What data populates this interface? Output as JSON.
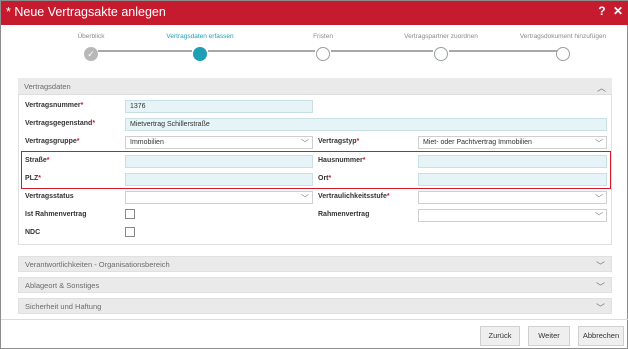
{
  "window": {
    "title": "* Neue Vertragsakte anlegen",
    "help_icon": "?",
    "close_icon": "✕"
  },
  "stepper": {
    "steps": [
      {
        "label": "Überblick",
        "state": "done"
      },
      {
        "label": "Vertragsdaten erfassen",
        "state": "active"
      },
      {
        "label": "Fristen",
        "state": "pending"
      },
      {
        "label": "Vertragspartner zuordnen",
        "state": "pending"
      },
      {
        "label": "Vertragsdokument hinzufügen",
        "state": "pending"
      }
    ],
    "done_icon": "✓"
  },
  "vertragsdaten": {
    "section_title": "Vertragsdaten",
    "vertragsnummer": {
      "label": "Vertragsnummer",
      "value": "1376"
    },
    "vertragsgegenstand": {
      "label": "Vertragsgegenstand",
      "value": "Mietvertrag Schillerstraße"
    },
    "vertragsgruppe": {
      "label": "Vertragsgruppe",
      "value": "Immobilien"
    },
    "vertragstyp": {
      "label": "Vertragstyp",
      "value": "Miet- oder Pachtvertrag Immobilien"
    },
    "strasse": {
      "label": "Straße",
      "value": ""
    },
    "hausnummer": {
      "label": "Hausnummer",
      "value": ""
    },
    "plz": {
      "label": "PLZ",
      "value": ""
    },
    "ort": {
      "label": "Ort",
      "value": ""
    },
    "vertragsstatus": {
      "label": "Vertragsstatus",
      "value": ""
    },
    "vertraulichkeitsstufe": {
      "label": "Vertraulichkeitsstufe",
      "value": ""
    },
    "ist_rahmenvertrag": {
      "label": "Ist Rahmenvertrag",
      "checked": false
    },
    "rahmenvertrag": {
      "label": "Rahmenvertrag",
      "value": ""
    },
    "ndc": {
      "label": "NDC",
      "checked": false
    },
    "required_marker": "*"
  },
  "sections": [
    {
      "title": "Verantwortlichkeiten - Organisationsbereich"
    },
    {
      "title": "Ablageort & Sonstiges"
    },
    {
      "title": "Sicherheit und Haftung"
    }
  ],
  "footer": {
    "back_label": "Zurück",
    "next_label": "Weiter",
    "cancel_label": "Abbrechen"
  },
  "colors": {
    "titlebar": "#c61b2f",
    "active_step": "#1e9fb4",
    "highlight": "#d11a2a"
  }
}
